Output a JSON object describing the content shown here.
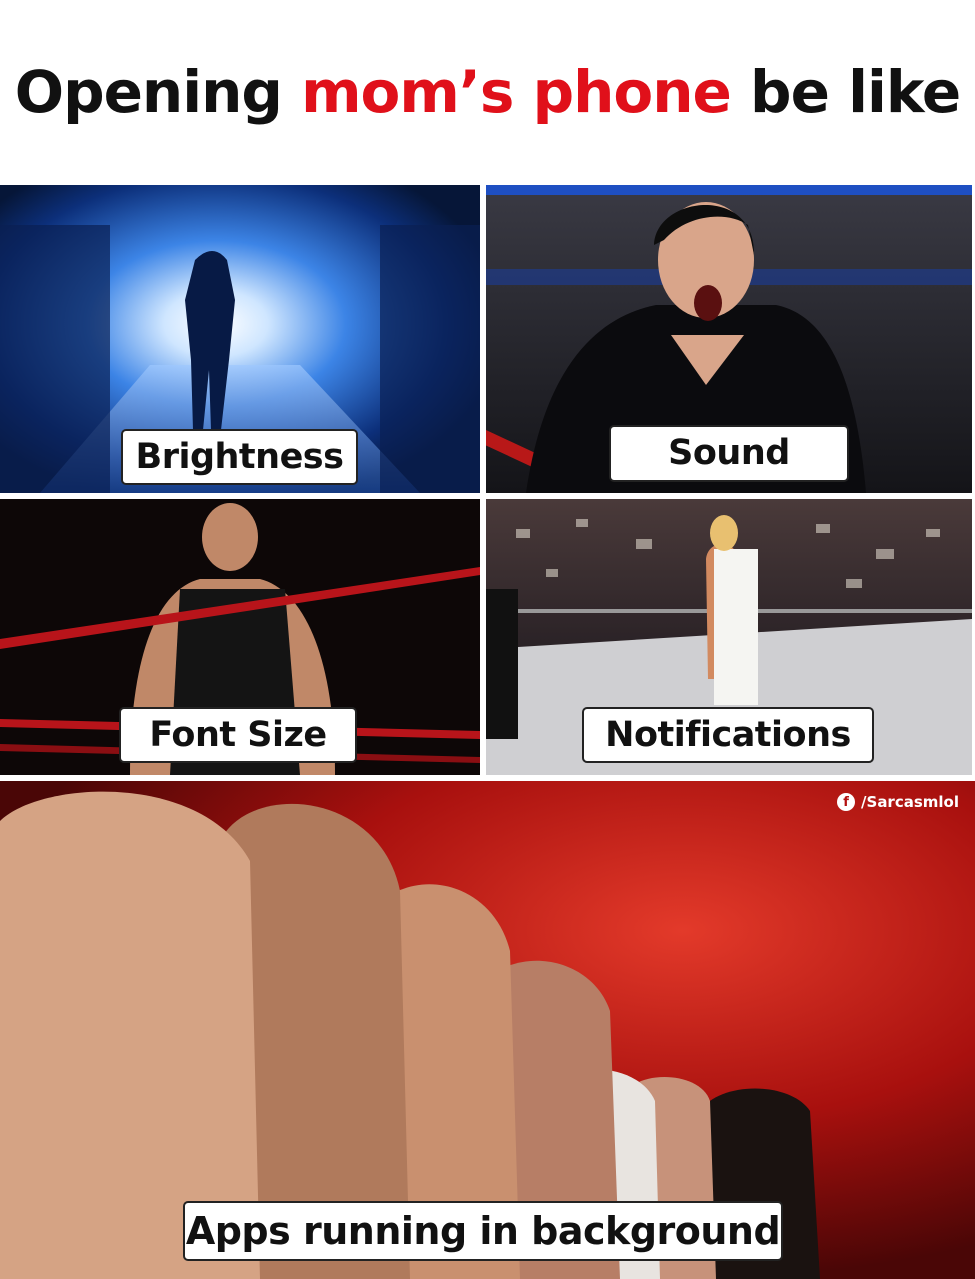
{
  "title": {
    "part1": "Opening ",
    "part2": "mom’s phone",
    "part3": " be like"
  },
  "colors": {
    "title_text": "#111111",
    "title_accent": "#e0101a",
    "label_bg": "#ffffff",
    "label_border": "#222222"
  },
  "panels": [
    {
      "label": "Brightness"
    },
    {
      "label": "Sound"
    },
    {
      "label": "Font Size"
    },
    {
      "label": "Notifications"
    },
    {
      "label": "Apps running in background"
    }
  ],
  "watermark": {
    "icon": "facebook-icon",
    "icon_glyph": "f",
    "handle": "/Sarcasmlol"
  }
}
